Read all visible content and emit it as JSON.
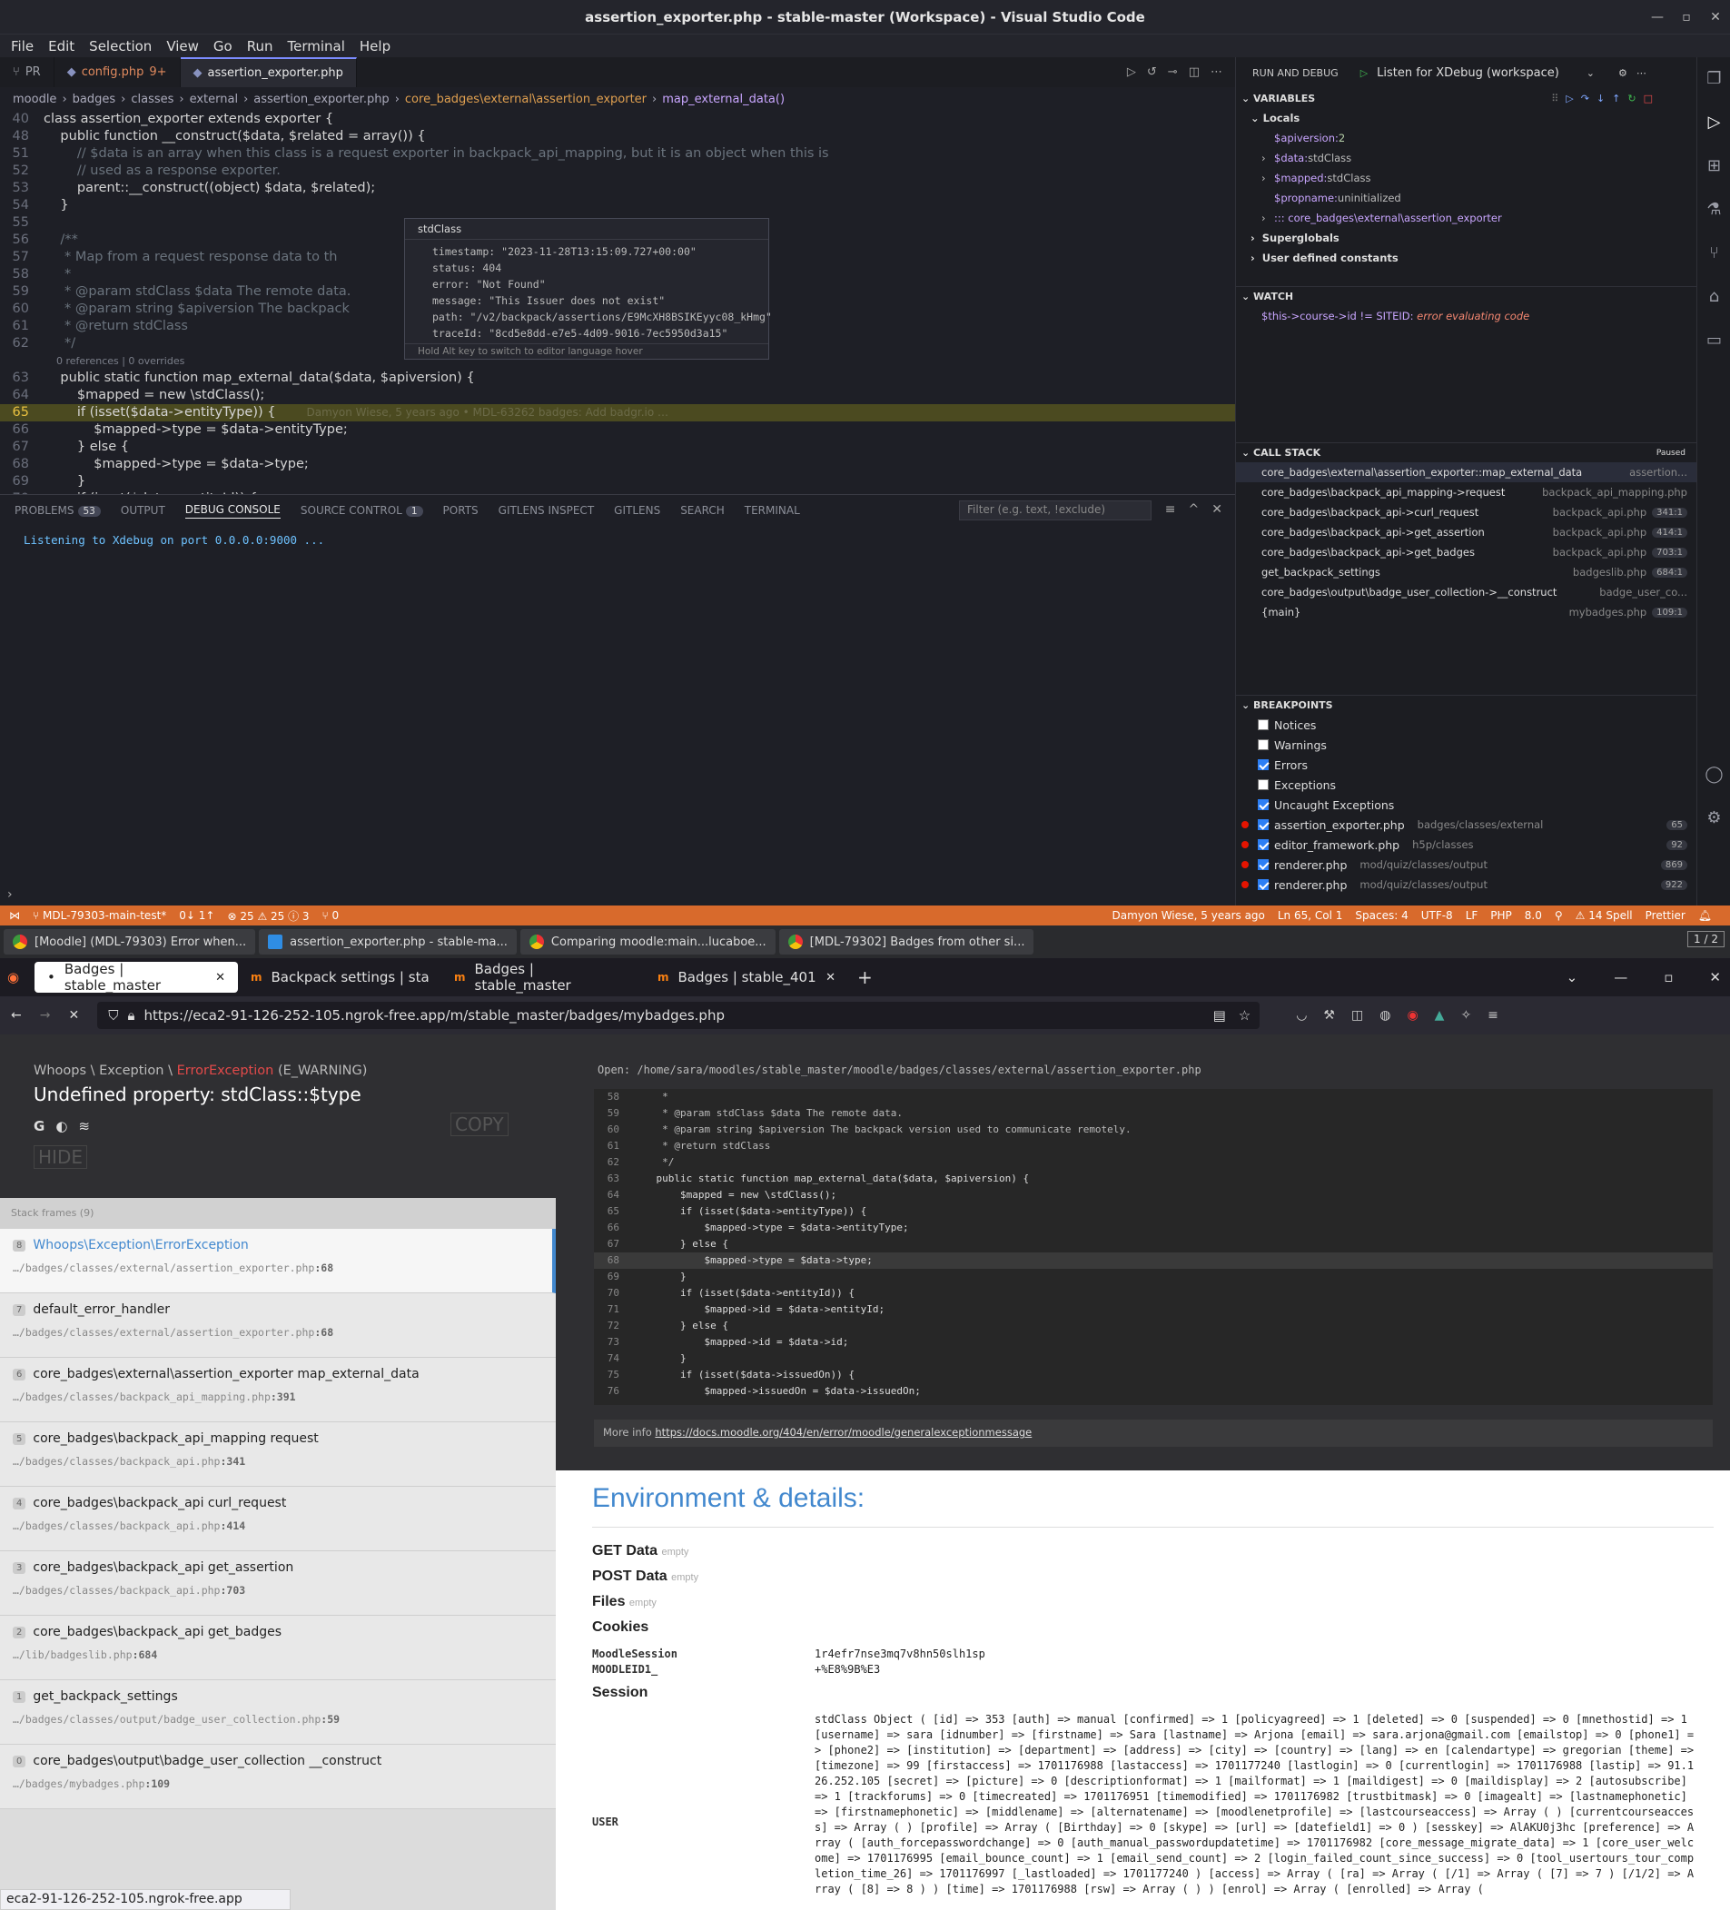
{
  "vscode": {
    "title": "assertion_exporter.php - stable-master (Workspace) - Visual Studio Code",
    "menu": [
      "File",
      "Edit",
      "Selection",
      "View",
      "Go",
      "Run",
      "Terminal",
      "Help"
    ],
    "tabs": [
      {
        "label": "PR",
        "modified": ""
      },
      {
        "label": "config.php",
        "modified": "9+"
      },
      {
        "label": "assertion_exporter.php",
        "modified": ""
      }
    ],
    "breadcrumb": [
      "moodle",
      "badges",
      "classes",
      "external",
      "assertion_exporter.php",
      "core_badges\\external\\assertion_exporter",
      "map_external_data()"
    ],
    "code_lines": [
      {
        "n": "40",
        "t": "class assertion_exporter extends exporter {"
      },
      {
        "n": "48",
        "t": "    public function __construct($data, $related = array()) {"
      },
      {
        "n": "51",
        "t": "        // $data is an array when this class is a request exporter in backpack_api_mapping, but it is an object when this is"
      },
      {
        "n": "52",
        "t": "        // used as a response exporter."
      },
      {
        "n": "53",
        "t": "        parent::__construct((object) $data, $related);"
      },
      {
        "n": "54",
        "t": "    }"
      },
      {
        "n": "55",
        "t": ""
      },
      {
        "n": "56",
        "t": "    /**"
      },
      {
        "n": "57",
        "t": "     * Map from a request response data to th"
      },
      {
        "n": "58",
        "t": "     *"
      },
      {
        "n": "59",
        "t": "     * @param stdClass $data The remote data."
      },
      {
        "n": "60",
        "t": "     * @param string $apiversion The backpack"
      },
      {
        "n": "61",
        "t": "     * @return stdClass"
      },
      {
        "n": "62",
        "t": "     */"
      },
      {
        "n": "",
        "t": "    0 references | 0 overrides"
      },
      {
        "n": "63",
        "t": "    public static function map_external_data($data, $apiversion) {"
      },
      {
        "n": "64",
        "t": "        $mapped = new \\stdClass();"
      },
      {
        "n": "65",
        "t": "        if (isset($data->entityType)) {"
      },
      {
        "n": "66",
        "t": "            $mapped->type = $data->entityType;"
      },
      {
        "n": "67",
        "t": "        } else {"
      },
      {
        "n": "68",
        "t": "            $mapped->type = $data->type;"
      },
      {
        "n": "69",
        "t": "        }"
      },
      {
        "n": "70",
        "t": "        if (isset($data->entityId)) {"
      }
    ],
    "blame": "Damyon Wiese, 5 years ago • MDL-63262 badges: Add badgr.io …",
    "hover": {
      "title": "stdClass",
      "fields": [
        "timestamp: \"2023-11-28T13:15:09.727+00:00\"",
        "status: 404",
        "error: \"Not Found\"",
        "message: \"This Issuer does not exist\"",
        "path: \"/v2/backpack/assertions/E9McXH8BSIKEyyc08_kHmg\"",
        "traceId: \"8cd5e8dd-e7e5-4d09-9016-7ec5950d3a15\""
      ],
      "footer": "Hold Alt key to switch to editor language hover"
    },
    "panel": {
      "tabs": [
        {
          "label": "PROBLEMS",
          "badge": "53"
        },
        {
          "label": "OUTPUT",
          "badge": ""
        },
        {
          "label": "DEBUG CONSOLE",
          "badge": ""
        },
        {
          "label": "SOURCE CONTROL",
          "badge": "1"
        },
        {
          "label": "PORTS",
          "badge": ""
        },
        {
          "label": "GITLENS INSPECT",
          "badge": ""
        },
        {
          "label": "GITLENS",
          "badge": ""
        },
        {
          "label": "SEARCH",
          "badge": ""
        },
        {
          "label": "TERMINAL",
          "badge": ""
        }
      ],
      "filter_placeholder": "Filter (e.g. text, !exclude)",
      "console_text": "Listening to Xdebug on port 0.0.0.0:9000 ..."
    },
    "debug": {
      "header": "RUN AND DEBUG",
      "config": "Listen for XDebug (workspace)",
      "variables_label": "VARIABLES",
      "locals_label": "Locals",
      "locals": [
        {
          "name": "$apiversion:",
          "value": "2",
          "expandable": false
        },
        {
          "name": "$data:",
          "value": "stdClass",
          "expandable": true
        },
        {
          "name": "$mapped:",
          "value": "stdClass",
          "expandable": true
        },
        {
          "name": "$propname:",
          "value": "uninitialized",
          "expandable": false
        },
        {
          "name": "::: core_badges\\external\\assertion_exporter",
          "value": "",
          "expandable": true
        }
      ],
      "superglobals": "Superglobals",
      "user_constants": "User defined constants",
      "watch_label": "WATCH",
      "watch_expr": "$this->course->id != SITEID:",
      "watch_val": "error evaluating code",
      "callstack_label": "CALL STACK",
      "paused": "Paused",
      "frames": [
        {
          "fn": "core_badges\\external\\assertion_exporter::map_external_data",
          "file": "assertion...",
          "line": ""
        },
        {
          "fn": "core_badges\\backpack_api_mapping->request",
          "file": "backpack_api_mapping.php",
          "line": ""
        },
        {
          "fn": "core_badges\\backpack_api->curl_request",
          "file": "backpack_api.php",
          "line": "341:1"
        },
        {
          "fn": "core_badges\\backpack_api->get_assertion",
          "file": "backpack_api.php",
          "line": "414:1"
        },
        {
          "fn": "core_badges\\backpack_api->get_badges",
          "file": "backpack_api.php",
          "line": "703:1"
        },
        {
          "fn": "get_backpack_settings",
          "file": "badgeslib.php",
          "line": "684:1"
        },
        {
          "fn": "core_badges\\output\\badge_user_collection->__construct",
          "file": "badge_user_co...",
          "line": ""
        },
        {
          "fn": "{main}",
          "file": "mybadges.php",
          "line": "109:1"
        }
      ],
      "breakpoints_label": "BREAKPOINTS",
      "breakpoints": [
        {
          "label": "Notices",
          "path": "",
          "line": "",
          "checked": false,
          "dot": false
        },
        {
          "label": "Warnings",
          "path": "",
          "line": "",
          "checked": false,
          "dot": false
        },
        {
          "label": "Errors",
          "path": "",
          "line": "",
          "checked": true,
          "dot": false
        },
        {
          "label": "Exceptions",
          "path": "",
          "line": "",
          "checked": false,
          "dot": false
        },
        {
          "label": "Uncaught Exceptions",
          "path": "",
          "line": "",
          "checked": true,
          "dot": false
        },
        {
          "label": "assertion_exporter.php",
          "path": "badges/classes/external",
          "line": "65",
          "checked": true,
          "dot": true
        },
        {
          "label": "editor_framework.php",
          "path": "h5p/classes",
          "line": "92",
          "checked": true,
          "dot": true
        },
        {
          "label": "renderer.php",
          "path": "mod/quiz/classes/output",
          "line": "869",
          "checked": true,
          "dot": true
        },
        {
          "label": "renderer.php",
          "path": "mod/quiz/classes/output",
          "line": "922",
          "checked": true,
          "dot": true
        }
      ]
    },
    "status": {
      "branch": "MDL-79303-main-test*",
      "sync": "0↓ 1↑",
      "problems": "⊗ 25 ⚠ 25 ⓘ 3",
      "ports": "⑂ 0",
      "blame": "Damyon Wiese, 5 years ago",
      "position": "Ln 65, Col 1",
      "spaces": "Spaces: 4",
      "encoding": "UTF-8",
      "eol": "LF",
      "lang": "PHP",
      "ver": "8.0",
      "spell": "⚠ 14 Spell",
      "prettier": "Prettier"
    }
  },
  "taskbar": {
    "items": [
      {
        "label": "[Moodle] (MDL-79303) Error when...",
        "icon": "chrome"
      },
      {
        "label": "assertion_exporter.php - stable-ma...",
        "icon": "vscode"
      },
      {
        "label": "Comparing moodle:main...lucaboe...",
        "icon": "chrome"
      },
      {
        "label": "[MDL-79302] Badges from other si...",
        "icon": "chrome"
      }
    ],
    "page": "1 / 2"
  },
  "firefox": {
    "tabs": [
      {
        "label": "Badges | stable_master",
        "active": true
      },
      {
        "label": "Backpack settings | stable",
        "active": false
      },
      {
        "label": "Badges | stable_master",
        "active": false
      },
      {
        "label": "Badges | stable_401",
        "active": false
      }
    ],
    "url": "https://eca2-91-126-252-105.ngrok-free.app/m/stable_master/badges/mybadges.php",
    "status_url": "eca2-91-126-252-105.ngrok-free.app"
  },
  "whoops": {
    "sub_prefix": "Whoops \\ Exception \\",
    "sub_err": "ErrorException",
    "sub_suffix": "(E_WARNING)",
    "title": "Undefined property: stdClass::$type",
    "copy": "COPY",
    "hide": "HIDE",
    "frames_label": "Stack frames (9)",
    "frames": [
      {
        "num": "8",
        "fn": "Whoops\\Exception\\ErrorException",
        "path": "…/badges/classes/external/assertion_exporter.php",
        "line": "68"
      },
      {
        "num": "7",
        "fn": "default_error_handler",
        "path": "…/badges/classes/external/assertion_exporter.php",
        "line": "68"
      },
      {
        "num": "6",
        "fn": "core_badges\\external\\assertion_exporter map_external_data",
        "path": "…/badges/classes/backpack_api_mapping.php",
        "line": "391"
      },
      {
        "num": "5",
        "fn": "core_badges\\backpack_api_mapping request",
        "path": "…/badges/classes/backpack_api.php",
        "line": "341"
      },
      {
        "num": "4",
        "fn": "core_badges\\backpack_api curl_request",
        "path": "…/badges/classes/backpack_api.php",
        "line": "414"
      },
      {
        "num": "3",
        "fn": "core_badges\\backpack_api get_assertion",
        "path": "…/badges/classes/backpack_api.php",
        "line": "703"
      },
      {
        "num": "2",
        "fn": "core_badges\\backpack_api get_badges",
        "path": "…/lib/badgeslib.php",
        "line": "684"
      },
      {
        "num": "1",
        "fn": "get_backpack_settings",
        "path": "…/badges/classes/output/badge_user_collection.php",
        "line": "59"
      },
      {
        "num": "0",
        "fn": "core_badges\\output\\badge_user_collection __construct",
        "path": "…/badges/mybadges.php",
        "line": "109"
      }
    ],
    "open_label": "Open:",
    "open_path": "/home/sara/moodles/stable_master/moodle/badges/classes/external/assertion_exporter.php",
    "code": [
      {
        "n": "58",
        "t": "     *"
      },
      {
        "n": "59",
        "t": "     * @param stdClass $data The remote data."
      },
      {
        "n": "60",
        "t": "     * @param string $apiversion The backpack version used to communicate remotely."
      },
      {
        "n": "61",
        "t": "     * @return stdClass"
      },
      {
        "n": "62",
        "t": "     */"
      },
      {
        "n": "63",
        "t": "    public static function map_external_data($data, $apiversion) {"
      },
      {
        "n": "64",
        "t": "        $mapped = new \\stdClass();"
      },
      {
        "n": "65",
        "t": "        if (isset($data->entityType)) {"
      },
      {
        "n": "66",
        "t": "            $mapped->type = $data->entityType;"
      },
      {
        "n": "67",
        "t": "        } else {"
      },
      {
        "n": "68",
        "t": "            $mapped->type = $data->type;"
      },
      {
        "n": "69",
        "t": "        }"
      },
      {
        "n": "70",
        "t": "        if (isset($data->entityId)) {"
      },
      {
        "n": "71",
        "t": "            $mapped->id = $data->entityId;"
      },
      {
        "n": "72",
        "t": "        } else {"
      },
      {
        "n": "73",
        "t": "            $mapped->id = $data->id;"
      },
      {
        "n": "74",
        "t": "        }"
      },
      {
        "n": "75",
        "t": "        if (isset($data->issuedOn)) {"
      },
      {
        "n": "76",
        "t": "            $mapped->issuedOn = $data->issuedOn;"
      }
    ],
    "more_info_label": "More info",
    "more_info_link": "https://docs.moodle.org/404/en/error/moodle/generalexceptionmessage",
    "env_title": "Environment & details:",
    "get": "GET Data",
    "post": "POST Data",
    "files": "Files",
    "empty": "empty",
    "cookies": "Cookies",
    "cookie_rows": [
      {
        "k": "MoodleSession",
        "v": "1r4efr7nse3mq7v8hn50slh1sp"
      },
      {
        "k": "MOODLEID1_",
        "v": "+%E8%9B%E3"
      }
    ],
    "session": "Session",
    "user_key": "USER",
    "session_dump": "stdClass Object ( [id] => 353 [auth] => manual [confirmed] => 1 [policyagreed] => 1 [deleted] => 0 [suspended] => 0 [mnethostid] => 1 [username] => sara [idnumber] => [firstname] => Sara [lastname] => Arjona [email] => sara.arjona@gmail.com [emailstop] => 0 [phone1] => [phone2] => [institution] => [department] => [address] => [city] => [country] => [lang] => en [calendartype] => gregorian [theme] => [timezone] => 99 [firstaccess] => 1701176988 [lastaccess] => 1701177240 [lastlogin] => 0 [currentlogin] => 1701176988 [lastip] => 91.126.252.105 [secret] => [picture] => 0 [descriptionformat] => 1 [mailformat] => 1 [maildigest] => 0 [maildisplay] => 2 [autosubscribe] => 1 [trackforums] => 0 [timecreated] => 1701176951 [timemodified] => 1701176982 [trustbitmask] => 0 [imagealt] => [lastnamephonetic] => [firstnamephonetic] => [middlename] => [alternatename] => [moodlenetprofile] => [lastcourseaccess] => Array ( ) [currentcourseaccess] => Array ( ) [profile] => Array ( [Birthday] => 0 [skype] => [url] => [datefield1] => 0 ) [sesskey] => AlAKU0j3hc [preference] => Array ( [auth_forcepasswordchange] => 0 [auth_manual_passwordupdatetime] => 1701176982 [core_message_migrate_data] => 1 [core_user_welcome] => 1701176995 [email_bounce_count] => 1 [email_send_count] => 2 [login_failed_count_since_success] => 0 [tool_usertours_tour_completion_time_26] => 1701176997 [_lastloaded] => 1701177240 ) [access] => Array ( [ra] => Array ( [/1] => Array ( [7] => 7 ) [/1/2] => Array ( [8] => 8 ) ) [time] => 1701176988 [rsw] => Array ( ) ) [enrol] => Array ( [enrolled] => Array ("
  }
}
